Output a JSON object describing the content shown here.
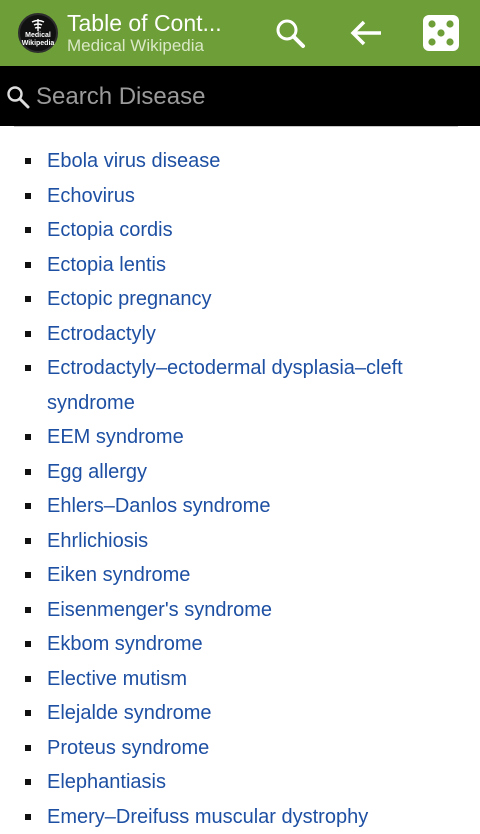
{
  "appbar": {
    "logo_line1": "Medical",
    "logo_line2": "Wikipedia",
    "title": "Table of Cont...",
    "subtitle": "Medical Wikipedia"
  },
  "search": {
    "placeholder": "Search Disease"
  },
  "icons": {
    "search": "search-icon",
    "back": "arrow-left-icon",
    "random": "dice-icon"
  },
  "colors": {
    "appbar": "#6e9e37",
    "link": "#1d4fa3",
    "searchbar": "#000000"
  },
  "items": [
    "Ebola virus disease",
    "Echovirus",
    "Ectopia cordis",
    "Ectopia lentis",
    "Ectopic pregnancy",
    "Ectrodactyly",
    "Ectrodactyly–ectodermal dysplasia–cleft syndrome",
    "EEM syndrome",
    "Egg allergy",
    "Ehlers–Danlos syndrome",
    "Ehrlichiosis",
    "Eiken syndrome",
    "Eisenmenger's syndrome",
    "Ekbom syndrome",
    "Elective mutism",
    "Elejalde syndrome",
    "Proteus syndrome",
    "Elephantiasis",
    "Emery–Dreifuss muscular dystrophy"
  ]
}
